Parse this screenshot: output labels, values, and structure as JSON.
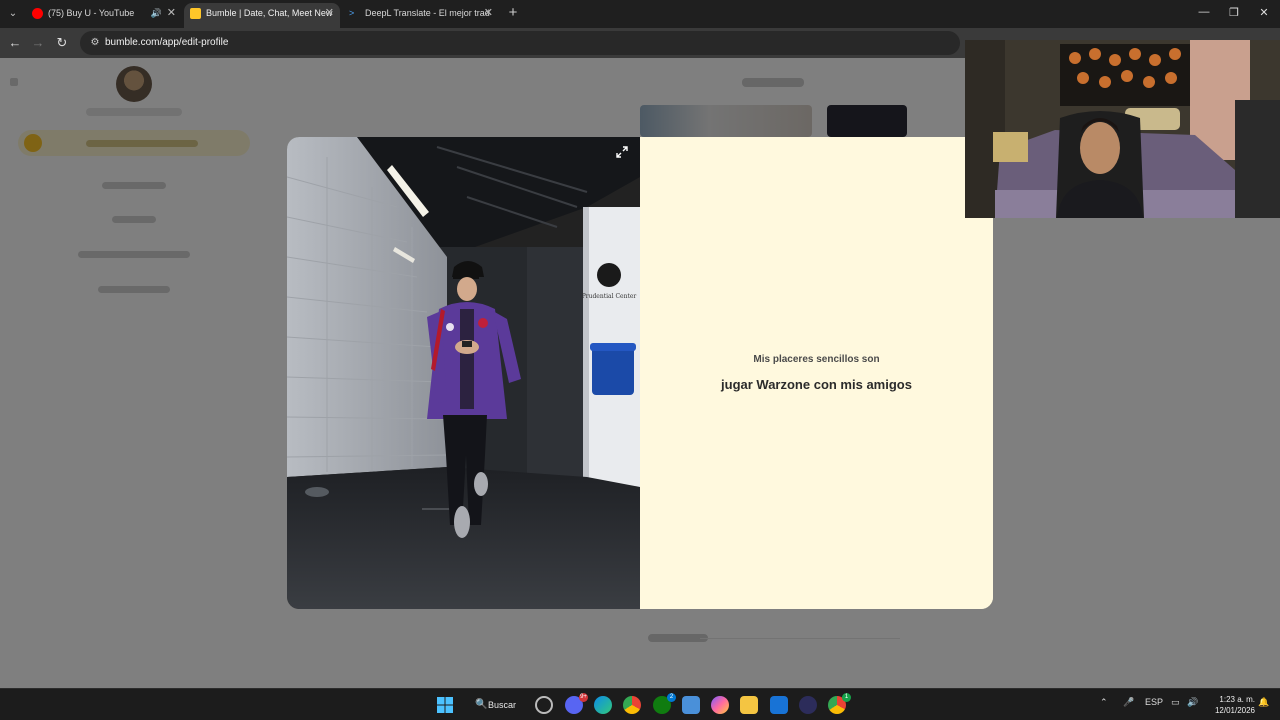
{
  "browser": {
    "tabs": [
      {
        "title": "(75) Buy U - YouTube",
        "favicon": "youtube-icon",
        "muted_icon": "speaker-icon"
      },
      {
        "title": "Bumble | Date, Chat, Meet New",
        "favicon": "bumble-icon",
        "active": true
      },
      {
        "title": "DeepL Translate - El mejor trad",
        "favicon": "deepl-icon"
      }
    ],
    "url": "bumble.com/app/edit-profile"
  },
  "modal": {
    "prompt_question": "Mis placeres sencillos son",
    "prompt_answer": "jugar Warzone con mis amigos"
  },
  "photo": {
    "wall_sign": "Prudential Center"
  },
  "taskbar": {
    "search_label": "Buscar",
    "discord_badge": "9+",
    "xbox_badge": "2",
    "chrome_badge": "1",
    "language": "ESP",
    "time": "1:23 a. m.",
    "date": "12/01/2026"
  },
  "colors": {
    "bumble_yellow": "#ffc629",
    "modal_bg": "#fff9de",
    "jacket_purple": "#5b3a9a"
  }
}
